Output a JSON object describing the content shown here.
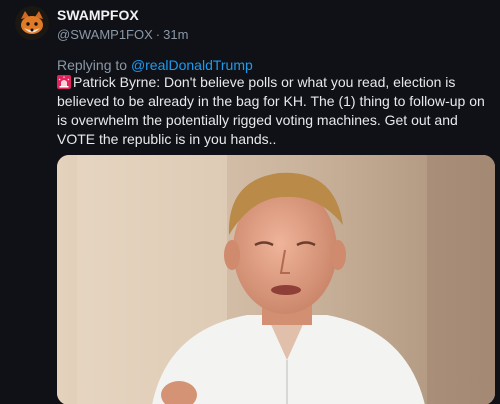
{
  "author": {
    "display_name": "SWAMPFOX",
    "handle": "@SWAMP1FOX",
    "separator": "·",
    "time_ago": "31m",
    "avatar_icon": "fox-avatar-icon"
  },
  "reply": {
    "prefix": "Replying to",
    "mention": "@realDonaldTrump"
  },
  "post": {
    "emoji_icon": "police-siren-icon",
    "text": "Patrick Byrne: Don't believe polls or what you read, election is believed to be already in the bag for KH. The (1) thing to follow-up on is overwhelm the potentially rigged voting machines. Get out and VOTE the republic is in you hands.."
  },
  "media": {
    "type": "video-thumbnail",
    "subject": "man-speaking-in-white-shirt"
  },
  "colors": {
    "background": "#0f1117",
    "text_primary": "#e7e9ea",
    "text_secondary": "#8b98a5",
    "link": "#1d9bf0",
    "siren_red": "#e0245e"
  }
}
